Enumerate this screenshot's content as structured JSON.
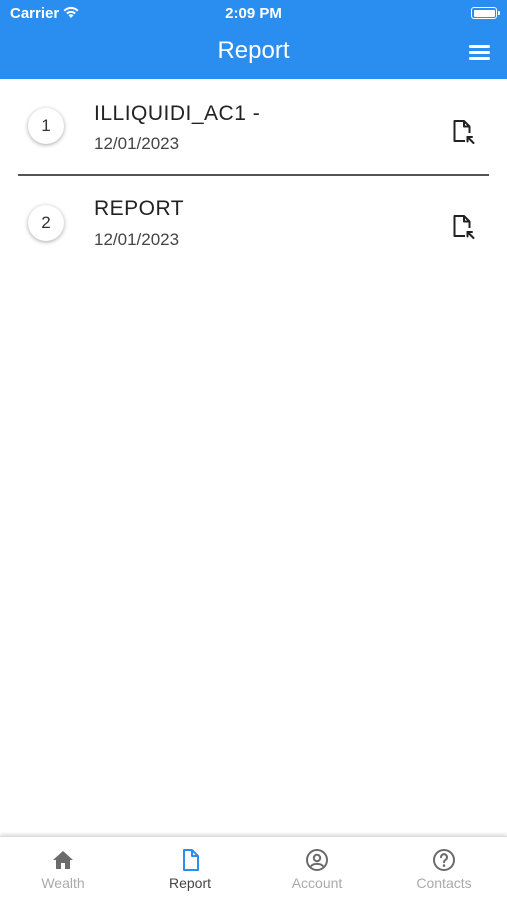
{
  "status_bar": {
    "carrier": "Carrier",
    "time": "2:09 PM"
  },
  "header": {
    "title": "Report"
  },
  "reports": [
    {
      "index": "1",
      "name": "ILLIQUIDI_AC1 -",
      "date": "12/01/2023"
    },
    {
      "index": "2",
      "name": "REPORT",
      "date": "12/01/2023"
    }
  ],
  "tabs": [
    {
      "label": "Wealth",
      "icon": "home-icon",
      "active": false
    },
    {
      "label": "Report",
      "icon": "document-icon",
      "active": true
    },
    {
      "label": "Account",
      "icon": "account-icon",
      "active": false
    },
    {
      "label": "Contacts",
      "icon": "help-icon",
      "active": false
    }
  ],
  "colors": {
    "header": "#2a8ef0",
    "active_tab": "#2a8ef0",
    "inactive_tab": "#aaaaaa"
  }
}
